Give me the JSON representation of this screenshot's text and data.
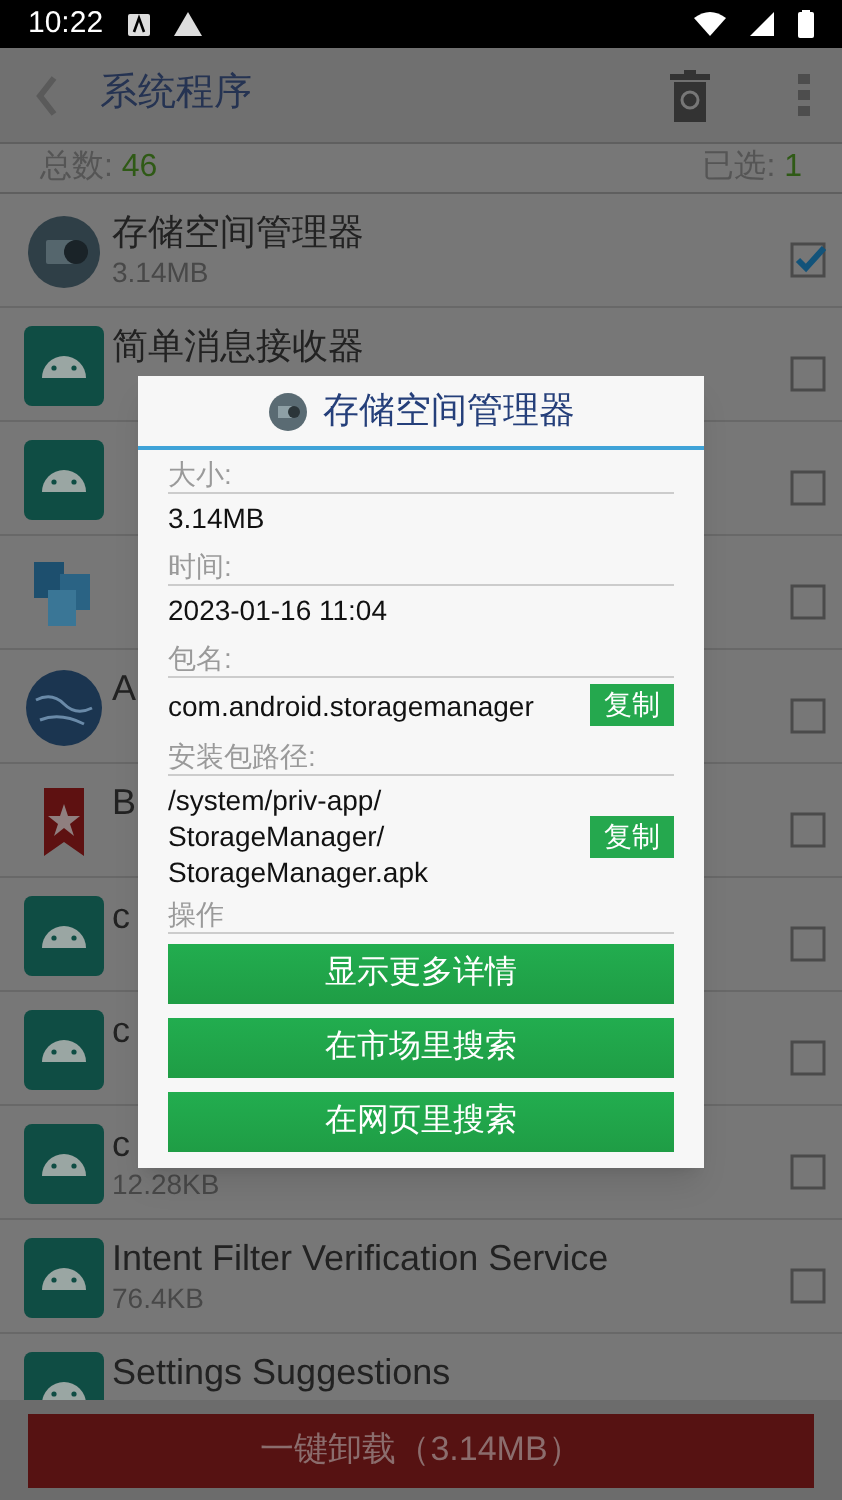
{
  "status_bar": {
    "time": "10:22"
  },
  "app_bar": {
    "title": "系统程序"
  },
  "summary": {
    "total_label": "总数: ",
    "total": "46",
    "selected_label": "已选: ",
    "selected": "1"
  },
  "apps": [
    {
      "name": "存储空间管理器",
      "size": "3.14MB",
      "checked": true,
      "kind": "storage"
    },
    {
      "name": "简单消息接收器",
      "checked": false,
      "kind": "android"
    },
    {
      "checked": false,
      "kind": "android"
    },
    {
      "checked": false,
      "kind": "photos"
    },
    {
      "name": "A",
      "checked": false,
      "kind": "globe"
    },
    {
      "name": "B",
      "checked": false,
      "kind": "bookmark"
    },
    {
      "name": "c",
      "checked": false,
      "kind": "android"
    },
    {
      "name": "c",
      "checked": false,
      "kind": "android"
    },
    {
      "name": "c",
      "size": "12.28KB",
      "checked": false,
      "kind": "android"
    },
    {
      "name": "Intent Filter Verification Service",
      "size": "76.4KB",
      "checked": false,
      "kind": "android"
    },
    {
      "name": "Settings Suggestions",
      "kind": "android"
    }
  ],
  "dialog": {
    "title": "存储空间管理器",
    "fields": [
      {
        "label": "大小:",
        "value": "3.14MB"
      },
      {
        "label": "时间:",
        "value": "2023-01-16 11:04"
      },
      {
        "label": "包名:",
        "value": "com.android.storagemanager",
        "copy": "复制"
      },
      {
        "label": "安装包路径:",
        "value": "/system/priv-app/\nStorageManager/\nStorageManager.apk",
        "copy": "复制"
      }
    ],
    "actions_label": "操作",
    "actions": [
      "显示更多详情",
      "在市场里搜索",
      "在网页里搜索"
    ]
  },
  "uninstall_button": "一键卸载（3.14MB）"
}
